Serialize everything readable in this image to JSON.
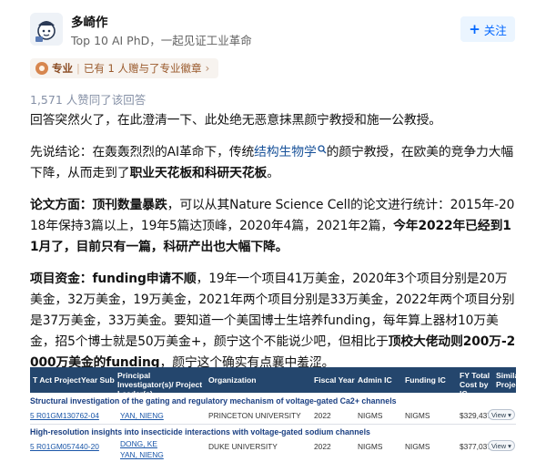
{
  "author": {
    "name": "多崎作",
    "bio": "Top 10 AI PhD，一起见证工业革命",
    "follow_label": "关注"
  },
  "badge": {
    "label": "专业",
    "text": "已有 1 人赠与了专业徽章"
  },
  "stats": {
    "agree_text": "1,571 人赞同了该回答"
  },
  "content": {
    "p1": "回答突然火了，在此澄清一下、此处绝无恶意抹黑颜宁教授和施一公教授。",
    "p2_a": "先说结论：在轰轰烈烈的AI革命下，传统",
    "p2_link": "结构生物学",
    "p2_b": "的颜宁教授，在欧美的竞争力大幅下降，从而走到了",
    "p2_bold": "职业天花板和科研天花板",
    "p2_end": "。",
    "p3_bold": "论文方面：顶刊数量暴跌",
    "p3_a": "，可以从其Nature Science Cell的论文进行统计：2015年-2018年保持3篇以上，19年5篇达顶峰，2020年4篇，2021年2篇，",
    "p3_bold2": "今年2022年已经到11月了，目前只有一篇，科研产出也大幅下降。",
    "p4_bold": "项目资金：funding申请不顺",
    "p4_a": "，19年一个项目41万美金，2020年3个项目分别是20万美金，32万美金，19万美金，2021年两个项目分别是33万美金，2022年两个项目分别是37万美金，33万美金。要知道一个美国博士生培养funding，每年算上器材10万美金，招5个博士就是50万美金+，颜宁这个不能说少吧，但相比于",
    "p4_bold2": "顶校大佬动则200万-2000万美金的funding",
    "p4_b": "，颜宁这个确实有点襄中羞涩。"
  },
  "table": {
    "headers": {
      "project": "T Act Project",
      "year": "Year Sub",
      "pi": "Principal Investigator(s)/ Project Leader(s)",
      "org": "Organization",
      "fy": "Fiscal Year",
      "admin": "Admin IC",
      "funding": "Funding IC",
      "total": "FY Total Cost by IC",
      "similar": "Similar Projects"
    },
    "rows": [
      {
        "title": "Structural investigation of the gating and regulatory mechanism of voltage-gated Ca2+ channels",
        "project": "5 R01GM130762-04",
        "pi": "YAN, NIENG",
        "org": "PRINCETON UNIVERSITY",
        "fy": "2022",
        "admin": "NIGMS",
        "funding": "NIGMS",
        "total": "$329,437",
        "view": "View"
      },
      {
        "title": "High-resolution insights into insecticide interactions with voltage-gated sodium channels",
        "project": "5 R01GM057440-20",
        "pi": "DONG, KE",
        "pi2": "YAN, NIENG",
        "org": "DUKE UNIVERSITY",
        "fy": "2022",
        "admin": "NIGMS",
        "funding": "NIGMS",
        "total": "$377,037",
        "view": "View"
      }
    ]
  },
  "colors": {
    "accent": "#0066ff",
    "table_header": "#24466d",
    "badge_text": "#9a5a2c"
  }
}
